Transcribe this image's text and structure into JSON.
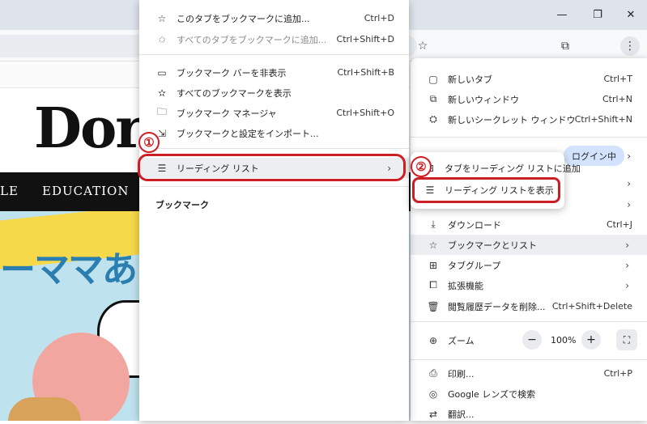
{
  "window_controls": {
    "minimize": "—",
    "restore": "❐",
    "close": "✕"
  },
  "toolbar": {
    "star": "☆",
    "extensions": "⧉",
    "menu": "⋮"
  },
  "page": {
    "logo_text": "Dor",
    "nav": [
      "LE",
      "EDUCATION"
    ],
    "hero_text": "ーママあ"
  },
  "bookmarks_menu": {
    "items": [
      {
        "icon": "star-icon",
        "glyph": "☆",
        "label": "このタブをブックマークに追加...",
        "shortcut": "Ctrl+D",
        "dim": false
      },
      {
        "icon": "star-multi-icon",
        "glyph": "✩",
        "label": "すべてのタブをブックマークに追加...",
        "shortcut": "Ctrl+Shift+D",
        "dim": true
      },
      {
        "icon": "bookmark-bar-icon",
        "glyph": "▭",
        "label": "ブックマーク バーを非表示",
        "shortcut": "Ctrl+Shift+B",
        "dim": false
      },
      {
        "icon": "all-bookmarks-icon",
        "glyph": "✫",
        "label": "すべてのブックマークを表示",
        "shortcut": "",
        "dim": false
      },
      {
        "icon": "folder-star-icon",
        "glyph": "🗀",
        "label": "ブックマーク マネージャ",
        "shortcut": "Ctrl+Shift+O",
        "dim": false
      },
      {
        "icon": "import-icon",
        "glyph": "⇲",
        "label": "ブックマークと設定をインポート...",
        "shortcut": "",
        "dim": false
      }
    ],
    "reading_list": {
      "icon": "reading-list-icon",
      "glyph": "☰",
      "label": "リーディング リスト",
      "arrow": "›"
    },
    "section_label": "ブックマーク"
  },
  "reading_submenu": {
    "items": [
      {
        "glyph": "⊞",
        "label": "タブをリーディング リストに追加"
      },
      {
        "glyph": "☰",
        "label": "リーディング リストを表示"
      }
    ]
  },
  "main_menu": {
    "top": [
      {
        "glyph": "▢",
        "label": "新しいタブ",
        "shortcut": "Ctrl+T"
      },
      {
        "glyph": "⧉",
        "label": "新しいウィンドウ",
        "shortcut": "Ctrl+N"
      },
      {
        "glyph": "⛭",
        "label": "新しいシークレット ウィンドウ",
        "shortcut": "Ctrl+Shift+N"
      }
    ],
    "login_chip": "ログイン中",
    "mid": [
      {
        "glyph": "⤓",
        "label": "ダウンロード",
        "shortcut": "Ctrl+J",
        "arrow": ""
      },
      {
        "glyph": "☆",
        "label": "ブックマークとリスト",
        "shortcut": "",
        "arrow": "›"
      },
      {
        "glyph": "⊞",
        "label": "タブグループ",
        "shortcut": "",
        "arrow": "›"
      },
      {
        "glyph": "⧠",
        "label": "拡張機能",
        "shortcut": "",
        "arrow": "›"
      },
      {
        "glyph": "🗑",
        "label": "閲覧履歴データを削除...",
        "shortcut": "Ctrl+Shift+Delete",
        "arrow": ""
      }
    ],
    "zoom": {
      "glyph": "⊕",
      "label": "ズーム",
      "minus": "−",
      "value": "100%",
      "plus": "+",
      "fullscreen": "⛶"
    },
    "bottom": [
      {
        "glyph": "⎙",
        "label": "印刷...",
        "shortcut": "Ctrl+P"
      },
      {
        "glyph": "◎",
        "label": "Google レンズで検索",
        "shortcut": ""
      },
      {
        "glyph": "⇄",
        "label": "翻訳...",
        "shortcut": ""
      }
    ]
  },
  "annotations": {
    "one": "①",
    "two": "②"
  }
}
